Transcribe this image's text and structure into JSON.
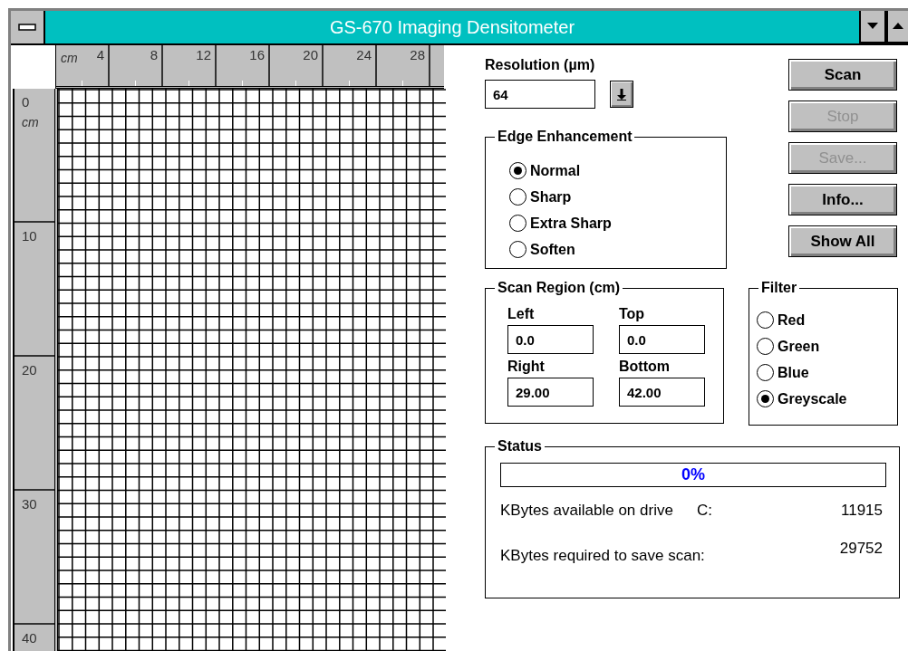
{
  "window": {
    "title": "GS-670 Imaging Densitometer"
  },
  "ruler_top": {
    "unit": "cm",
    "labels": [
      "4",
      "8",
      "12",
      "16",
      "20",
      "24",
      "28"
    ]
  },
  "ruler_left": {
    "unit": "cm",
    "labels": [
      "0",
      "10",
      "20",
      "30",
      "40"
    ]
  },
  "resolution": {
    "label": "Resolution (µm)",
    "value": "64"
  },
  "edge_enhancement": {
    "title": "Edge Enhancement",
    "options": [
      {
        "label": "Normal",
        "selected": true
      },
      {
        "label": "Sharp",
        "selected": false
      },
      {
        "label": "Extra Sharp",
        "selected": false
      },
      {
        "label": "Soften",
        "selected": false
      }
    ]
  },
  "buttons": [
    {
      "label": "Scan",
      "disabled": false
    },
    {
      "label": "Stop",
      "disabled": true
    },
    {
      "label": "Save...",
      "disabled": true
    },
    {
      "label": "Info...",
      "disabled": false
    },
    {
      "label": "Show All",
      "disabled": false
    }
  ],
  "scan_region": {
    "title": "Scan Region (cm)",
    "fields": [
      {
        "label": "Left",
        "value": "0.0"
      },
      {
        "label": "Top",
        "value": "0.0"
      },
      {
        "label": "Right",
        "value": "29.00"
      },
      {
        "label": "Bottom",
        "value": "42.00"
      }
    ]
  },
  "filter": {
    "title": "Filter",
    "options": [
      {
        "label": "Red",
        "selected": false
      },
      {
        "label": "Green",
        "selected": false
      },
      {
        "label": "Blue",
        "selected": false
      },
      {
        "label": "Greyscale",
        "selected": true
      }
    ]
  },
  "status": {
    "title": "Status",
    "progress": {
      "level": 0,
      "reading": "0%"
    },
    "drive_row": {
      "label": "KBytes available on drive",
      "drive": "C:",
      "value": "11915"
    },
    "required_row": {
      "label": "KBytes required to save scan:",
      "value": "29752"
    }
  }
}
